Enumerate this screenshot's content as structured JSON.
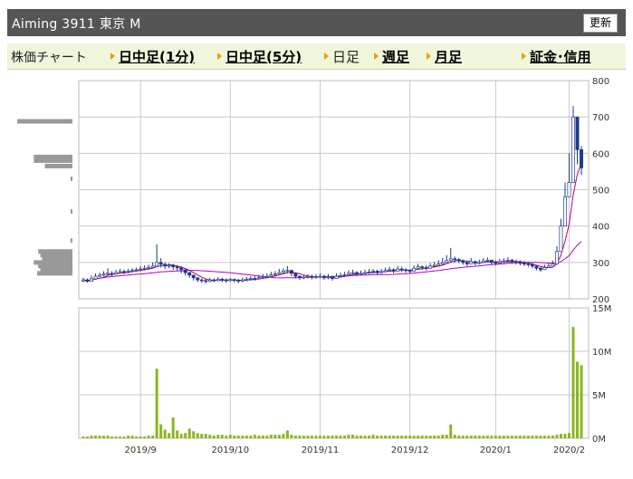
{
  "header": {
    "title": "Aiming  3911  東京 M",
    "refresh_label": "更新"
  },
  "nav": {
    "chart_label": "株価チャート",
    "intraday_1": "日中足(1分)",
    "intraday_5": "日中足(5分)",
    "daily": "日足",
    "weekly": "週足",
    "monthly": "月足",
    "margin": "証金･信用"
  },
  "colors": {
    "up": "#ffffff",
    "down": "#1a3a8c",
    "ma_short": "#c0006a",
    "ma_long": "#b000c8",
    "volume": "#8ab61e",
    "grid": "#c8c8c8",
    "profile": "#999999"
  },
  "chart_data": [
    {
      "type": "candlestick",
      "y_axis_ticks": [
        "800",
        "700",
        "600",
        "500",
        "400",
        "300",
        "200"
      ],
      "ylim": [
        200,
        800
      ],
      "x_tick_labels": [
        "2019/9",
        "2019/10",
        "2019/11",
        "2019/12",
        "2020/1",
        "2020/2"
      ],
      "grid": true,
      "close": [
        252,
        248,
        255,
        262,
        265,
        268,
        270,
        268,
        272,
        275,
        274,
        276,
        278,
        280,
        282,
        284,
        286,
        290,
        300,
        295,
        290,
        292,
        288,
        285,
        280,
        272,
        265,
        258,
        252,
        250,
        248,
        252,
        250,
        254,
        252,
        250,
        253,
        251,
        249,
        252,
        254,
        256,
        255,
        258,
        260,
        262,
        266,
        268,
        272,
        276,
        278,
        270,
        262,
        258,
        260,
        262,
        259,
        261,
        262,
        258,
        260,
        256,
        262,
        264,
        266,
        270,
        272,
        268,
        270,
        272,
        274,
        276,
        272,
        275,
        278,
        280,
        276,
        282,
        280,
        278,
        276,
        284,
        288,
        286,
        284,
        290,
        292,
        296,
        300,
        305,
        310,
        308,
        304,
        300,
        296,
        302,
        298,
        300,
        304,
        306,
        300,
        298,
        302,
        304,
        306,
        302,
        300,
        298,
        296,
        294,
        290,
        284,
        280,
        286,
        290,
        296,
        330,
        400,
        480,
        520,
        700,
        610,
        560
      ],
      "high": [
        258,
        256,
        264,
        270,
        272,
        276,
        284,
        276,
        280,
        282,
        280,
        282,
        284,
        286,
        290,
        292,
        294,
        300,
        350,
        312,
        300,
        298,
        296,
        292,
        290,
        280,
        274,
        266,
        258,
        256,
        254,
        258,
        256,
        260,
        258,
        256,
        258,
        256,
        255,
        258,
        260,
        262,
        262,
        266,
        268,
        270,
        274,
        276,
        282,
        284,
        290,
        280,
        268,
        264,
        266,
        268,
        266,
        268,
        270,
        266,
        268,
        264,
        270,
        272,
        274,
        278,
        280,
        276,
        278,
        280,
        282,
        282,
        280,
        282,
        286,
        288,
        284,
        290,
        288,
        284,
        282,
        292,
        296,
        292,
        292,
        298,
        302,
        306,
        312,
        320,
        340,
        316,
        312,
        308,
        304,
        312,
        306,
        308,
        312,
        314,
        308,
        306,
        310,
        312,
        314,
        310,
        308,
        306,
        304,
        300,
        298,
        292,
        288,
        294,
        298,
        305,
        345,
        420,
        520,
        600,
        730,
        650,
        620
      ],
      "low": [
        246,
        244,
        250,
        256,
        260,
        262,
        264,
        262,
        266,
        270,
        268,
        270,
        272,
        274,
        276,
        278,
        280,
        284,
        290,
        286,
        282,
        284,
        280,
        276,
        270,
        264,
        258,
        250,
        246,
        244,
        242,
        246,
        246,
        248,
        246,
        244,
        247,
        245,
        243,
        246,
        248,
        250,
        250,
        252,
        254,
        256,
        260,
        262,
        266,
        270,
        270,
        262,
        256,
        252,
        254,
        256,
        253,
        255,
        256,
        252,
        254,
        250,
        256,
        258,
        260,
        264,
        266,
        262,
        264,
        266,
        268,
        270,
        266,
        269,
        272,
        274,
        270,
        276,
        274,
        272,
        270,
        278,
        282,
        280,
        278,
        284,
        286,
        290,
        294,
        298,
        300,
        300,
        298,
        294,
        290,
        296,
        292,
        294,
        298,
        300,
        294,
        292,
        296,
        298,
        300,
        296,
        294,
        292,
        290,
        288,
        284,
        278,
        274,
        280,
        284,
        290,
        320,
        380,
        460,
        500,
        640,
        570,
        540
      ],
      "volume_axis_ticks": [
        "15M",
        "10M",
        "5M",
        "0M"
      ],
      "volume_ylim": [
        0,
        15
      ],
      "volume_millions": [
        0.2,
        0.2,
        0.3,
        0.3,
        0.3,
        0.3,
        0.3,
        0.2,
        0.2,
        0.2,
        0.2,
        0.3,
        0.3,
        0.2,
        0.2,
        0.2,
        0.3,
        0.3,
        8.0,
        1.6,
        1.0,
        0.6,
        2.4,
        0.9,
        0.5,
        0.6,
        1.1,
        0.8,
        0.6,
        0.5,
        0.5,
        0.4,
        0.3,
        0.4,
        0.4,
        0.3,
        0.4,
        0.3,
        0.3,
        0.3,
        0.3,
        0.3,
        0.4,
        0.3,
        0.3,
        0.3,
        0.4,
        0.4,
        0.4,
        0.5,
        0.9,
        0.4,
        0.3,
        0.3,
        0.3,
        0.3,
        0.3,
        0.3,
        0.3,
        0.3,
        0.3,
        0.3,
        0.3,
        0.3,
        0.3,
        0.4,
        0.4,
        0.3,
        0.3,
        0.3,
        0.3,
        0.4,
        0.3,
        0.3,
        0.3,
        0.3,
        0.3,
        0.3,
        0.3,
        0.3,
        0.3,
        0.3,
        0.3,
        0.3,
        0.3,
        0.3,
        0.3,
        0.3,
        0.4,
        0.4,
        1.6,
        0.4,
        0.3,
        0.3,
        0.3,
        0.3,
        0.3,
        0.3,
        0.3,
        0.3,
        0.3,
        0.3,
        0.3,
        0.3,
        0.3,
        0.3,
        0.3,
        0.3,
        0.3,
        0.3,
        0.3,
        0.3,
        0.3,
        0.3,
        0.3,
        0.3,
        0.4,
        0.5,
        0.5,
        0.6,
        12.8,
        8.8,
        8.4
      ],
      "ma_short_label": "",
      "ma_long_label": "",
      "price_volume_profile": [
        {
          "price": 688,
          "weight": 1.0
        },
        {
          "price": 590,
          "weight": 0.7
        },
        {
          "price": 580,
          "weight": 0.7
        },
        {
          "price": 565,
          "weight": 0.5
        },
        {
          "price": 530,
          "weight": 0.02
        },
        {
          "price": 440,
          "weight": 0.02
        },
        {
          "price": 360,
          "weight": 0.02
        },
        {
          "price": 330,
          "weight": 0.62
        },
        {
          "price": 320,
          "weight": 0.58
        },
        {
          "price": 310,
          "weight": 0.55
        },
        {
          "price": 300,
          "weight": 0.7
        },
        {
          "price": 290,
          "weight": 0.62
        },
        {
          "price": 280,
          "weight": 0.58
        },
        {
          "price": 270,
          "weight": 0.64
        }
      ]
    }
  ]
}
